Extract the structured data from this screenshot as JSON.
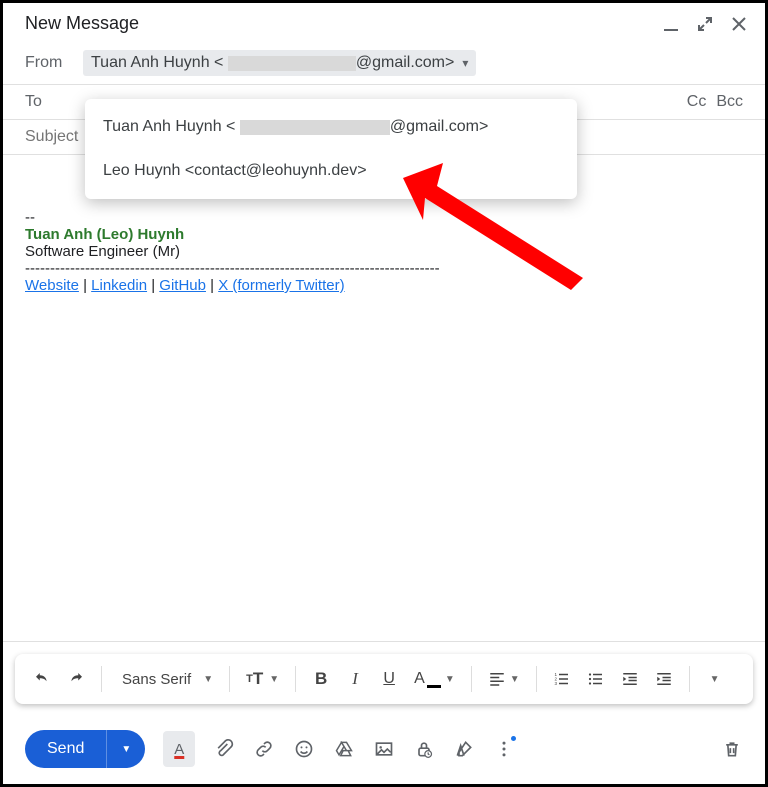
{
  "header": {
    "title": "New Message"
  },
  "from": {
    "label": "From",
    "display_name": "Tuan Anh Huynh",
    "email_suffix": "@gmail.com>"
  },
  "to": {
    "label": "To",
    "cc_label": "Cc",
    "bcc_label": "Bcc"
  },
  "subject": {
    "placeholder": "Subject"
  },
  "dropdown_options": [
    {
      "prefix": "Tuan Anh Huynh <",
      "suffix": "@gmail.com>",
      "redacted": true
    },
    {
      "text": "Leo Huynh <contact@leohuynh.dev>",
      "redacted": false
    }
  ],
  "signature": {
    "dashes": "--",
    "name": "Tuan Anh (Leo) Huynh",
    "role": "Software Engineer (Mr)",
    "hr": "-----------------------------------------------------------------------------------",
    "links": {
      "website": "Website",
      "linkedin": "Linkedin",
      "github": "GitHub",
      "twitter": "X (formerly Twitter)",
      "sep": " | "
    }
  },
  "format_toolbar": {
    "font_label": "Sans Serif"
  },
  "send": {
    "label": "Send"
  }
}
